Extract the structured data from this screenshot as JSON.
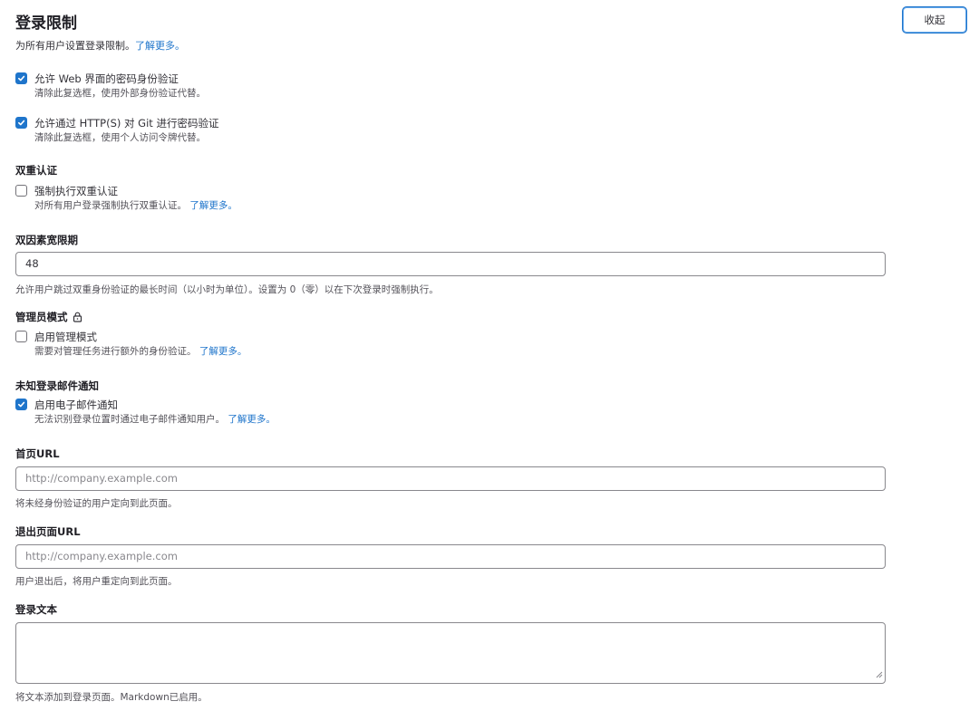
{
  "header": {
    "title": "登录限制",
    "collapse_label": "收起",
    "description": "为所有用户设置登录限制。",
    "learn_more": "了解更多。"
  },
  "password_web": {
    "label": "允许 Web 界面的密码身份验证",
    "help": "清除此复选框，使用外部身份验证代替。",
    "checked": true
  },
  "password_git": {
    "label": "允许通过 HTTP(S) 对 Git 进行密码验证",
    "help": "清除此复选框，使用个人访问令牌代替。",
    "checked": true
  },
  "two_factor": {
    "heading": "双重认证",
    "label": "强制执行双重认证",
    "help": "对所有用户登录强制执行双重认证。",
    "learn_more": "了解更多。",
    "checked": false
  },
  "grace_period": {
    "heading": "双因素宽限期",
    "value": "48",
    "help": "允许用户跳过双重身份验证的最长时间（以小时为单位）。设置为 0（零）以在下次登录时强制执行。"
  },
  "admin_mode": {
    "heading": "管理员模式",
    "icon": "lock-icon",
    "label": "启用管理模式",
    "help": "需要对管理任务进行额外的身份验证。",
    "learn_more": "了解更多。",
    "checked": false
  },
  "unknown_signin": {
    "heading": "未知登录邮件通知",
    "label": "启用电子邮件通知",
    "help": "无法识别登录位置时通过电子邮件通知用户。",
    "learn_more": "了解更多。",
    "checked": true
  },
  "home_url": {
    "heading": "首页URL",
    "placeholder": "http://company.example.com",
    "help": "将未经身份验证的用户定向到此页面。"
  },
  "signout_url": {
    "heading": "退出页面URL",
    "placeholder": "http://company.example.com",
    "help": "用户退出后，将用户重定向到此页面。"
  },
  "signin_text": {
    "heading": "登录文本",
    "help": "将文本添加到登录页面。Markdown已启用。"
  },
  "colors": {
    "accent": "#1f75cb",
    "text": "#333238",
    "muted": "#535158",
    "border": "#89888d"
  }
}
